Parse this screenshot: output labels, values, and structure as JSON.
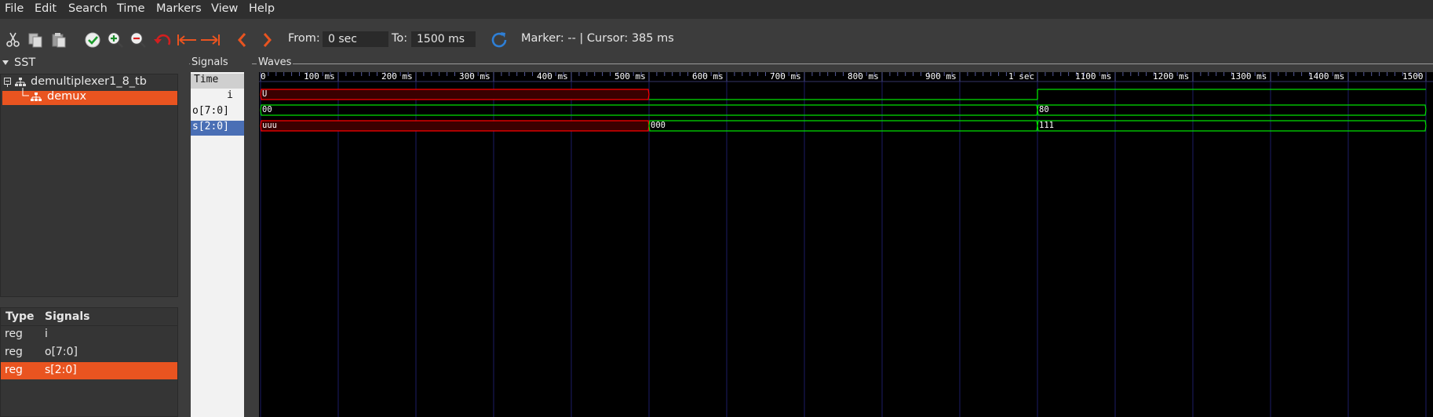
{
  "menu": [
    "File",
    "Edit",
    "Search",
    "Time",
    "Markers",
    "View",
    "Help"
  ],
  "toolbar": {
    "from_label": "From:",
    "from_value": "0 sec",
    "to_label": "To:",
    "to_value": "1500 ms",
    "status": "Marker: -- | Cursor: 385 ms",
    "icons": [
      "cut-icon",
      "copy-icon",
      "paste-icon",
      "zoom-fit-icon",
      "zoom-in-icon",
      "zoom-out-icon",
      "undo-icon",
      "zoom-to-start-icon",
      "zoom-to-end-icon",
      "previous-edge-icon",
      "next-edge-icon",
      "reload-icon"
    ]
  },
  "sst": {
    "title": "SST",
    "tree": [
      {
        "label": "demultiplexer1_8_tb"
      },
      {
        "label": "demux"
      }
    ],
    "signals_header": {
      "type": "Type",
      "signals": "Signals"
    },
    "signals": [
      {
        "type": "reg",
        "name": "i"
      },
      {
        "type": "reg",
        "name": "o[7:0]"
      },
      {
        "type": "reg",
        "name": "s[2:0]"
      }
    ]
  },
  "signals_pane": {
    "title": "Signals",
    "header": "Time",
    "rows": [
      "i",
      "o[7:0]",
      "s[2:0]"
    ]
  },
  "waves": {
    "title": "Waves",
    "tick_labels": [
      "0",
      "100 ms",
      "200 ms",
      "300 ms",
      "400 ms",
      "500 ms",
      "600 ms",
      "700 ms",
      "800 ms",
      "900 ms",
      "1 sec",
      "1100 ms",
      "1200 ms",
      "1300 ms",
      "1400 ms",
      "1500"
    ],
    "traces": [
      {
        "signal": "i",
        "segments": [
          {
            "start": 0,
            "end": 500,
            "value": "U",
            "state": "undefined"
          },
          {
            "start": 500,
            "end": 1000,
            "value": "0",
            "state": "low"
          },
          {
            "start": 1000,
            "end": 1500,
            "value": "1",
            "state": "high"
          }
        ]
      },
      {
        "signal": "o[7:0]",
        "segments": [
          {
            "start": 0,
            "end": 1000,
            "value": "00",
            "state": "bus"
          },
          {
            "start": 1000,
            "end": 1500,
            "value": "80",
            "state": "bus"
          }
        ]
      },
      {
        "signal": "s[2:0]",
        "segments": [
          {
            "start": 0,
            "end": 500,
            "value": "uuu",
            "state": "undefined"
          },
          {
            "start": 500,
            "end": 1000,
            "value": "000",
            "state": "bus"
          },
          {
            "start": 1000,
            "end": 1500,
            "value": "111",
            "state": "bus"
          }
        ]
      }
    ],
    "colors": {
      "undefined": "#ff0000",
      "valid": "#00e000",
      "grid": "#1b1b66",
      "accent": "#e95420"
    }
  }
}
